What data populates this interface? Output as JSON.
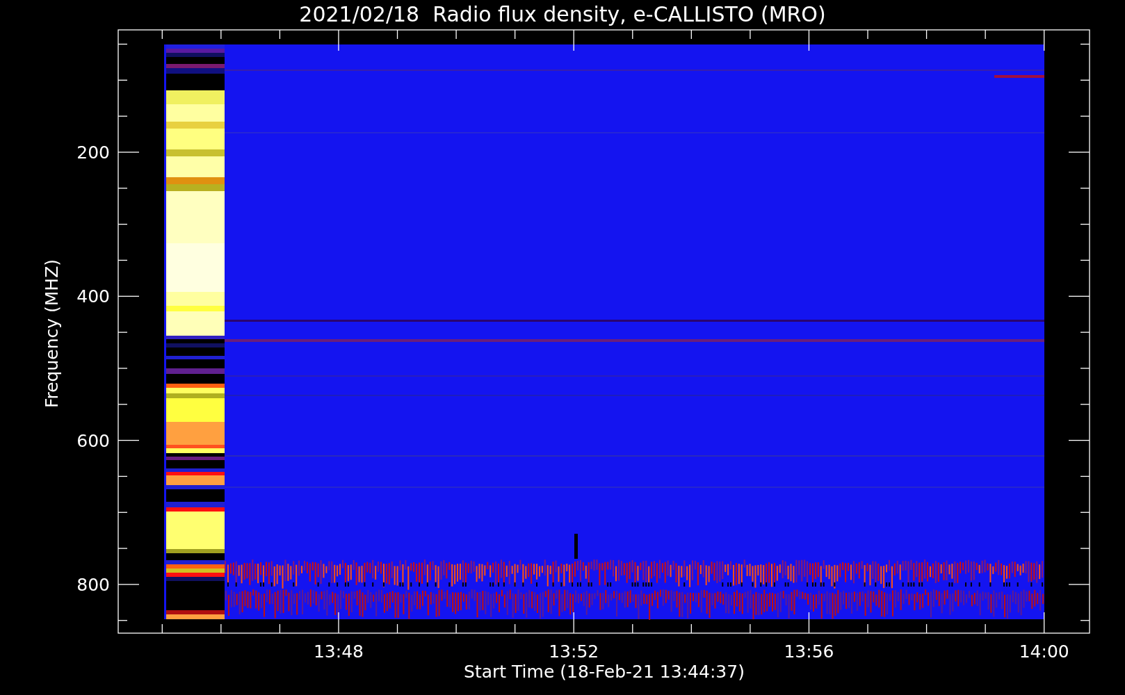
{
  "title": "2021/02/18  Radio flux density, e-CALLISTO (MRO)",
  "plot": {
    "y_axis": {
      "title": "Frequency (MHZ)",
      "tick_labels": [
        "200",
        "400",
        "600",
        "800"
      ]
    },
    "x_axis": {
      "title": "Start Time (18-Feb-21 13:44:37)",
      "tick_labels": [
        "13:48",
        "13:52",
        "13:56",
        "14:00"
      ]
    }
  }
}
